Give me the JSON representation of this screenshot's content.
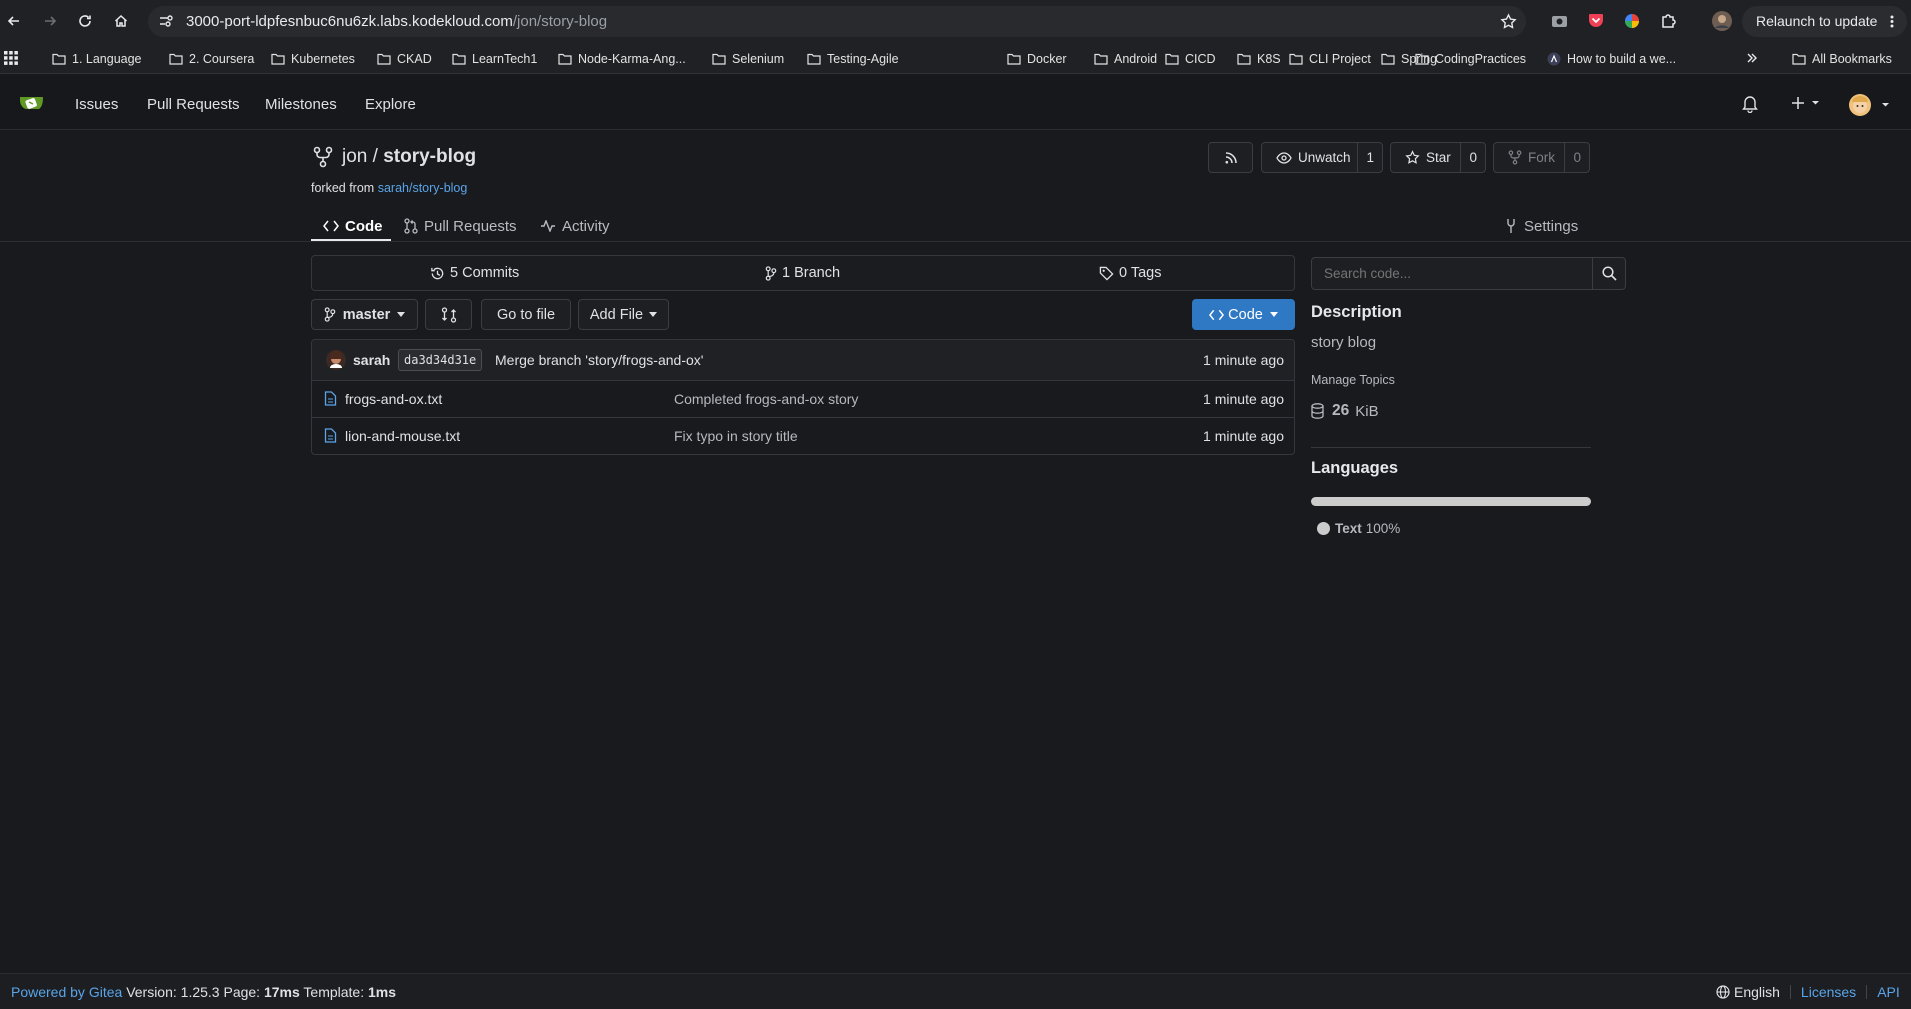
{
  "browser": {
    "url_host": "3000-port-ldpfesnbuc6nu6zk.labs.kodekloud.com",
    "url_path": "/jon/story-blog",
    "relaunch_label": "Relaunch to update",
    "bookmarks": [
      "1. Language",
      "2. Coursera",
      "Kubernetes",
      "CKAD",
      "LearnTech1",
      "Node-Karma-Ang...",
      "Selenium",
      "Testing-Agile",
      "Docker",
      "Android",
      "CICD",
      "K8S",
      "CLI Project",
      "Spring",
      "CodingPractices",
      "How to build a we..."
    ],
    "all_bookmarks": "All Bookmarks"
  },
  "nav": {
    "issues": "Issues",
    "pull_requests": "Pull Requests",
    "milestones": "Milestones",
    "explore": "Explore"
  },
  "repo": {
    "owner": "jon",
    "separator": "/",
    "name": "story-blog",
    "forked_prefix": "forked from",
    "forked_from": "sarah/story-blog",
    "unwatch_label": "Unwatch",
    "unwatch_count": "1",
    "star_label": "Star",
    "star_count": "0",
    "fork_label": "Fork",
    "fork_count": "0"
  },
  "tabs": {
    "code": "Code",
    "pull_requests": "Pull Requests",
    "activity": "Activity",
    "settings": "Settings"
  },
  "stats": {
    "commits": "5 Commits",
    "branches": "1 Branch",
    "tags": "0 Tags"
  },
  "toolbar": {
    "branch": "master",
    "go_to_file": "Go to file",
    "add_file": "Add File",
    "code": "Code"
  },
  "latest_commit": {
    "author": "sarah",
    "sha": "da3d34d31e",
    "message": "Merge branch 'story/frogs-and-ox'",
    "time": "1 minute ago"
  },
  "files": [
    {
      "name": "frogs-and-ox.txt",
      "message": "Completed frogs-and-ox story",
      "time": "1 minute ago"
    },
    {
      "name": "lion-and-mouse.txt",
      "message": "Fix typo in story title",
      "time": "1 minute ago"
    }
  ],
  "sidebar": {
    "search_placeholder": "Search code...",
    "description_heading": "Description",
    "description": "story blog",
    "manage_topics": "Manage Topics",
    "size_value": "26",
    "size_unit": "KiB",
    "languages_heading": "Languages",
    "language_name": "Text",
    "language_percent": "100%"
  },
  "footer": {
    "powered_by": "Powered by Gitea",
    "version_label": "Version: 1.25.3 Page:",
    "page_time": "17ms",
    "template_label": "Template:",
    "template_time": "1ms",
    "language": "English",
    "licenses": "Licenses",
    "api": "API"
  },
  "colors": {
    "accent": "#2f78c4",
    "link": "#5aa4e8",
    "gitea_logo": "#609926"
  }
}
